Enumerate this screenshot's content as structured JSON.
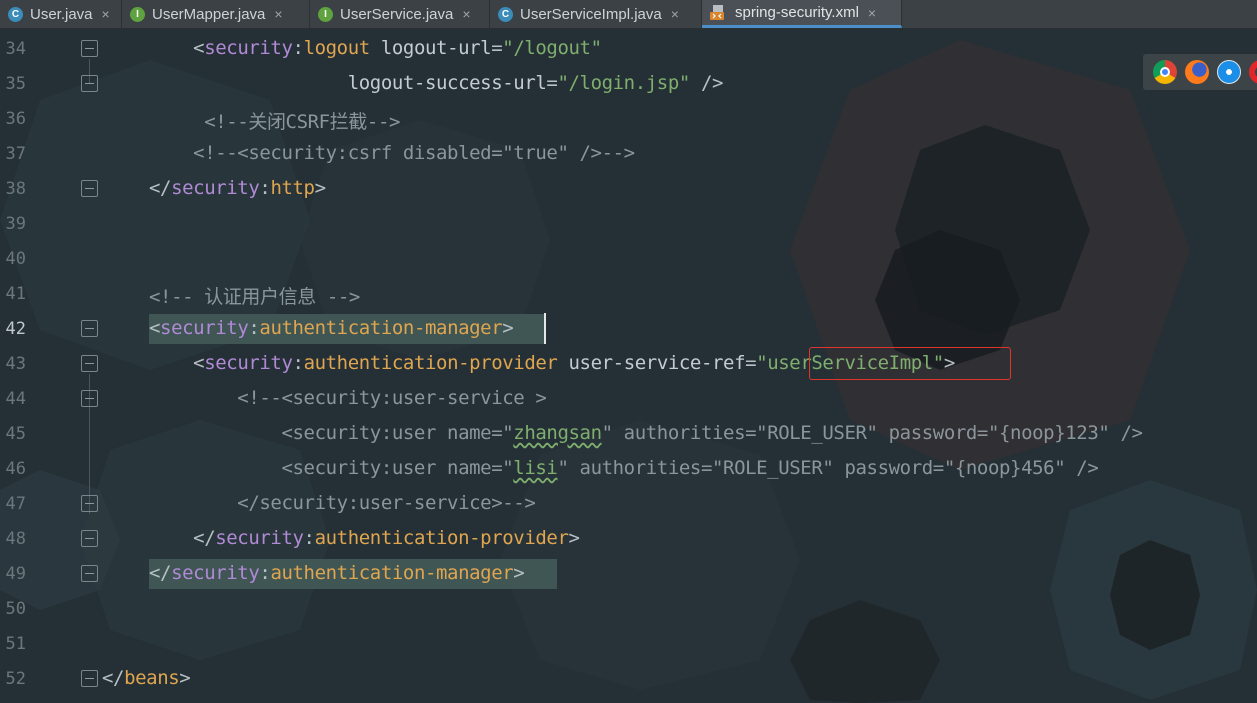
{
  "tabs": [
    {
      "label": "User.java",
      "icon": "class-icon",
      "active": false
    },
    {
      "label": "UserMapper.java",
      "icon": "interface-icon",
      "active": false
    },
    {
      "label": "UserService.java",
      "icon": "interface-icon",
      "active": false
    },
    {
      "label": "UserServiceImpl.java",
      "icon": "class-icon",
      "active": false
    },
    {
      "label": "spring-security.xml",
      "icon": "xml-file-icon",
      "active": true
    }
  ],
  "tab_close_glyph": "×",
  "browser_icons": [
    "chrome-icon",
    "firefox-icon",
    "safari-icon",
    "opera-icon"
  ],
  "current_line": 42,
  "highlighted_value": "userServiceImpl",
  "colors": {
    "background": "#253036",
    "tag": "#dfa54f",
    "namespace": "#b18ad6",
    "string": "#7fae6e",
    "comment": "#8b969b",
    "highlight_box": "#e0352b"
  },
  "lines": [
    {
      "num": "34",
      "tokens": [
        [
          "pu",
          "    <"
        ],
        [
          "ns",
          "security"
        ],
        [
          "pu",
          ":"
        ],
        [
          "tg",
          "logout"
        ],
        [
          "at",
          " logout-url"
        ],
        [
          "pu",
          "="
        ],
        [
          "sv",
          "\"/logout\""
        ]
      ]
    },
    {
      "num": "35",
      "tokens": [
        [
          "at",
          "                  logout-success-url"
        ],
        [
          "pu",
          "="
        ],
        [
          "sv",
          "\"/login.jsp\""
        ],
        [
          "pu",
          " />"
        ]
      ]
    },
    {
      "num": "36",
      "tokens": [
        [
          "cm",
          "     <!--关闭CSRF拦截-->"
        ]
      ]
    },
    {
      "num": "37",
      "tokens": [
        [
          "cm",
          "    <!--<security:csrf disabled=\"true\" />-->"
        ]
      ]
    },
    {
      "num": "38",
      "tokens": [
        [
          "pu",
          "</"
        ],
        [
          "ns",
          "security"
        ],
        [
          "pu",
          ":"
        ],
        [
          "tg",
          "http"
        ],
        [
          "pu",
          ">"
        ]
      ]
    },
    {
      "num": "39",
      "tokens": []
    },
    {
      "num": "40",
      "tokens": []
    },
    {
      "num": "41",
      "tokens": [
        [
          "cm",
          "<!-- 认证用户信息 -->"
        ]
      ]
    },
    {
      "num": "42",
      "tokens": [
        [
          "pu",
          "<"
        ],
        [
          "ns",
          "security"
        ],
        [
          "pu",
          ":"
        ],
        [
          "tg",
          "authentication-manager"
        ],
        [
          "pu",
          ">"
        ]
      ]
    },
    {
      "num": "43",
      "tokens": [
        [
          "pu",
          "    <"
        ],
        [
          "ns",
          "security"
        ],
        [
          "pu",
          ":"
        ],
        [
          "tg",
          "authentication-provider"
        ],
        [
          "at",
          " user-service-ref"
        ],
        [
          "pu",
          "="
        ],
        [
          "sv",
          "\"userServiceImpl\""
        ],
        [
          "pu",
          ">"
        ]
      ]
    },
    {
      "num": "44",
      "tokens": [
        [
          "cm",
          "        <!--<security:user-service >"
        ]
      ]
    },
    {
      "num": "45",
      "tokens": [
        [
          "cm",
          "            <security:user name=\""
        ],
        [
          "svsq",
          "zhangsan"
        ],
        [
          "cm",
          "\" authorities=\"ROLE_USER\" password=\"{noop}123\" />"
        ]
      ]
    },
    {
      "num": "46",
      "tokens": [
        [
          "cm",
          "            <security:user name=\""
        ],
        [
          "svsq",
          "lisi"
        ],
        [
          "cm",
          "\" authorities=\"ROLE_USER\" password=\"{noop}456\" />"
        ]
      ]
    },
    {
      "num": "47",
      "tokens": [
        [
          "cm",
          "        </security:user-service>-->"
        ]
      ]
    },
    {
      "num": "48",
      "tokens": [
        [
          "pu",
          "    </"
        ],
        [
          "ns",
          "security"
        ],
        [
          "pu",
          ":"
        ],
        [
          "tg",
          "authentication-provider"
        ],
        [
          "pu",
          ">"
        ]
      ]
    },
    {
      "num": "49",
      "tokens": [
        [
          "pu",
          "</"
        ],
        [
          "ns",
          "security"
        ],
        [
          "pu",
          ":"
        ],
        [
          "tg",
          "authentication-manager"
        ],
        [
          "pu",
          ">"
        ]
      ]
    },
    {
      "num": "50",
      "tokens": []
    },
    {
      "num": "51",
      "tokens": []
    },
    {
      "num": "52",
      "tokens": [
        [
          "pu",
          "</"
        ],
        [
          "tg",
          "beans"
        ],
        [
          "pu",
          ">"
        ]
      ]
    }
  ]
}
